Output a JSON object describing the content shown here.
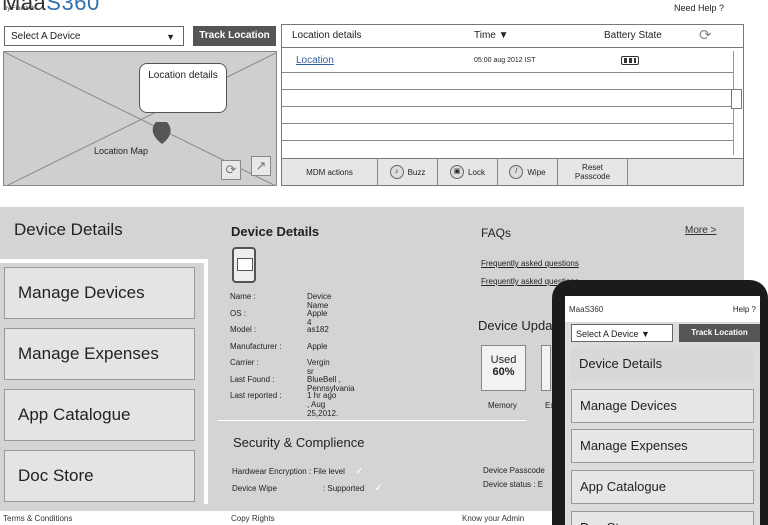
{
  "brand": {
    "logo_prefix": "Maa",
    "logo_suffix": "S360",
    "by_line": "by Fiberlink"
  },
  "header": {
    "need_help": "Need Help ?"
  },
  "device_select": {
    "label": "Select A Device",
    "arrow": "▼"
  },
  "track_button": "Track Location",
  "map": {
    "bubble": "Location details",
    "label": "Location Map",
    "refresh_glyph": "⟳",
    "expand_glyph": "↗"
  },
  "location_table": {
    "headers": {
      "details": "Location details",
      "time": "Time ▼",
      "battery": "Battery State"
    },
    "rows": [
      {
        "location": "Location",
        "time": "05:00 aug 2012 IST"
      }
    ],
    "actions": {
      "mdm": "MDM actions",
      "buzz": "Buzz",
      "lock": "Lock",
      "wipe": "Wipe",
      "reset_line1": "Reset",
      "reset_line2": "Passcode"
    }
  },
  "nav": {
    "active": "Device Details",
    "items": [
      "Manage Devices",
      "Manage Expenses",
      "App Catalogue",
      "Doc Store"
    ]
  },
  "device_details": {
    "title": "Device Details",
    "rows": [
      {
        "k": "Name :",
        "v": "Device Name"
      },
      {
        "k": "OS :",
        "v": "Apple 4"
      },
      {
        "k": "Model :",
        "v": "as182"
      },
      {
        "k": "Manufacturer :",
        "v": "Apple"
      },
      {
        "k": "Carrier :",
        "v": "Vergin sr"
      },
      {
        "k": "Last Found :",
        "v": "BlueBell , Pennsylvania"
      },
      {
        "k": "Last reported :",
        "v": "1 hr ago , Aug 25,2012."
      }
    ]
  },
  "security": {
    "title": "Security & Complience",
    "row1_k": "Hardwear Encryption :",
    "row1_v": "File level",
    "row2_k": "Device Wipe",
    "row2_v": ": Supported",
    "check": "✓",
    "right_row1": "Device Passcode",
    "right_row2": "Device status : E"
  },
  "faq": {
    "title": "FAQs",
    "more": "More >",
    "links": [
      "Frequently asked questions",
      "Frequently asked questions"
    ]
  },
  "device_updates": {
    "title": "Device Upda",
    "stat_used": "Used",
    "stat_pct": "60%",
    "stat_label": "Memory",
    "stat_label2": "Ex"
  },
  "footer": {
    "terms": "Terms & Conditions",
    "copy": "Copy Rights",
    "admin": "Know your Admin"
  },
  "phone": {
    "logo": "MaaS360",
    "help": "Help ?",
    "select": "Select A Device ▼",
    "track": "Track Location",
    "items": [
      "Device Details",
      "Manage Devices",
      "Manage Expenses",
      "App Catalogue",
      "Doc Store"
    ]
  }
}
